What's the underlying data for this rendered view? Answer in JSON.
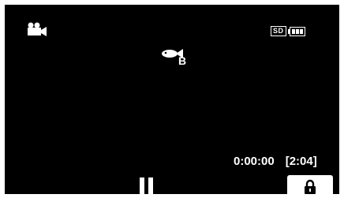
{
  "screen": {
    "mode_icon": "video-camera-icon",
    "status": {
      "media_label": "SD",
      "battery_icon": "battery-icon"
    },
    "scene": {
      "icon": "fish-icon",
      "letter": "B"
    },
    "time": {
      "elapsed": "0:00:00",
      "remaining": "[2:04]"
    },
    "controls": {
      "pause_icon": "pause-icon",
      "lock_icon": "lock-icon"
    },
    "colors": {
      "background": "#000000",
      "foreground": "#ffffff"
    }
  }
}
